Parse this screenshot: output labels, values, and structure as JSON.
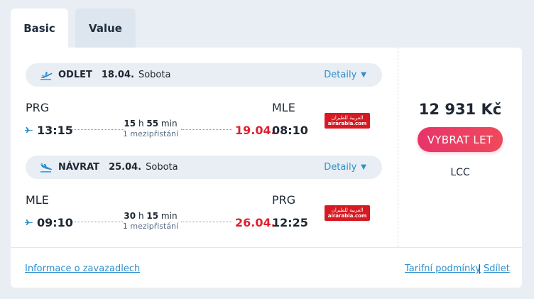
{
  "tabs": [
    {
      "label": "Basic",
      "active": true
    },
    {
      "label": "Value",
      "active": false
    }
  ],
  "outbound": {
    "direction": "ODLET",
    "date": "18.04.",
    "day": "Sobota",
    "details_label": "Detaily",
    "origin_code": "PRG",
    "dest_code": "MLE",
    "dep_time": "13:15",
    "duration_h": "15",
    "duration_h_unit": "h",
    "duration_m": "55",
    "duration_m_unit": "min",
    "stops": "1 mezipřistání",
    "arr_date": "19.04.",
    "arr_time": "08:10",
    "airline_logo_ar": "العربية للطيران",
    "airline_logo_en": "airarabia.com"
  },
  "inbound": {
    "direction": "NÁVRAT",
    "date": "25.04.",
    "day": "Sobota",
    "details_label": "Detaily",
    "origin_code": "MLE",
    "dest_code": "PRG",
    "dep_time": "09:10",
    "duration_h": "30",
    "duration_h_unit": "h",
    "duration_m": "15",
    "duration_m_unit": "min",
    "stops": "1 mezipřistání",
    "arr_date": "26.04.",
    "arr_time": "12:25",
    "airline_logo_ar": "العربية للطيران",
    "airline_logo_en": "airarabia.com"
  },
  "offer": {
    "price": "12 931 Kč",
    "select_label": "VYBRAT LET",
    "fare_type": "LCC"
  },
  "footer": {
    "baggage_link": "Informace o zavazadlech",
    "tariff_link": "Tarifní podmínky",
    "separator": "|",
    "share_link": "Sdílet"
  },
  "colors": {
    "accent": "#2c8fcf",
    "price_button": "#e8336a",
    "arrival_date": "#e0202f",
    "airline_red": "#d71921"
  },
  "icons": {
    "departure": "plane-takeoff-icon",
    "return": "plane-landing-icon",
    "caret": "caret-down-icon",
    "small_plane": "plane-icon"
  }
}
